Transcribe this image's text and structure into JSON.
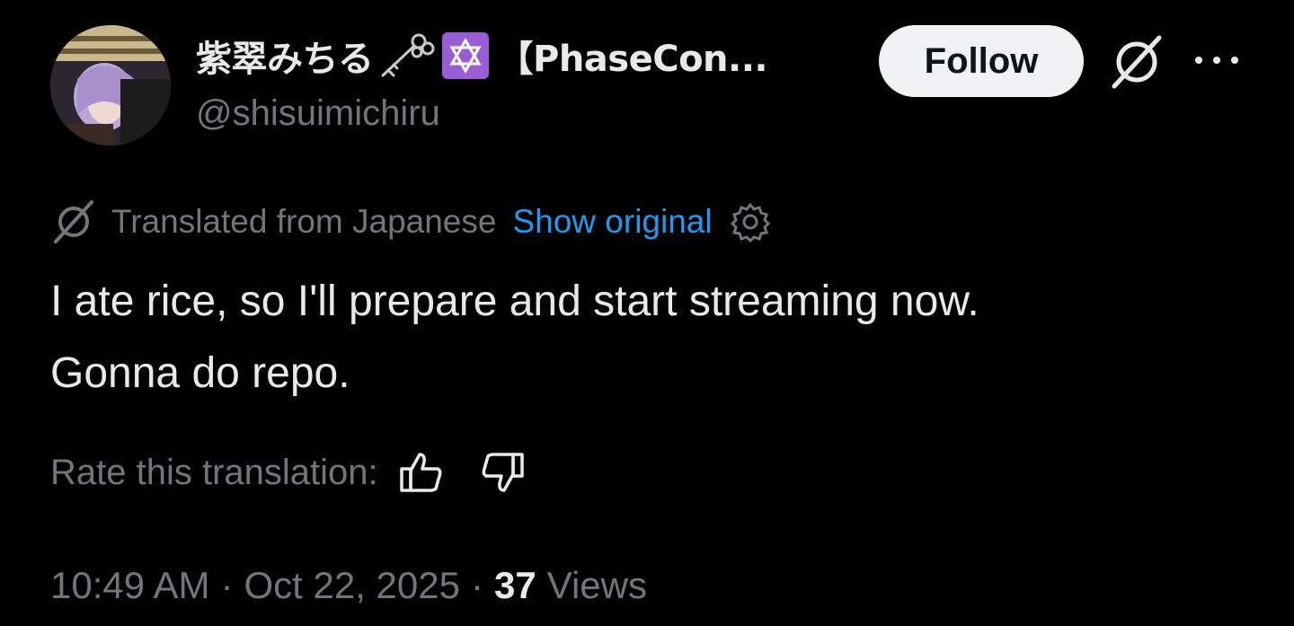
{
  "author": {
    "display_name": "紫翠みちる",
    "org_name": "【PhaseCon...",
    "handle": "@shisuimichiru",
    "avatar_icon": "avatar-image",
    "badges": [
      "key-icon",
      "star-of-david-icon"
    ]
  },
  "header_actions": {
    "follow_label": "Follow",
    "grok_icon": "grok-icon",
    "more_icon": "more-dots-icon"
  },
  "translation": {
    "translated_label": "Translated from Japanese",
    "show_original_label": "Show original",
    "settings_icon": "gear-icon"
  },
  "tweet": {
    "lines": [
      "I ate rice, so I'll prepare and start streaming now.",
      "Gonna do repo."
    ]
  },
  "rating": {
    "label": "Rate this translation:",
    "up_icon": "thumbs-up-icon",
    "down_icon": "thumbs-down-icon"
  },
  "meta": {
    "time": "10:49 AM",
    "date": "Oct 22, 2025",
    "view_count": "37",
    "views_label": "Views",
    "separator": "·"
  },
  "colors": {
    "background": "#000000",
    "text_primary": "#e7e9ea",
    "text_secondary": "#71767b",
    "link": "#1d9bf0",
    "follow_bg": "#eff3f4",
    "badge_purple": "#9b5dd6"
  }
}
